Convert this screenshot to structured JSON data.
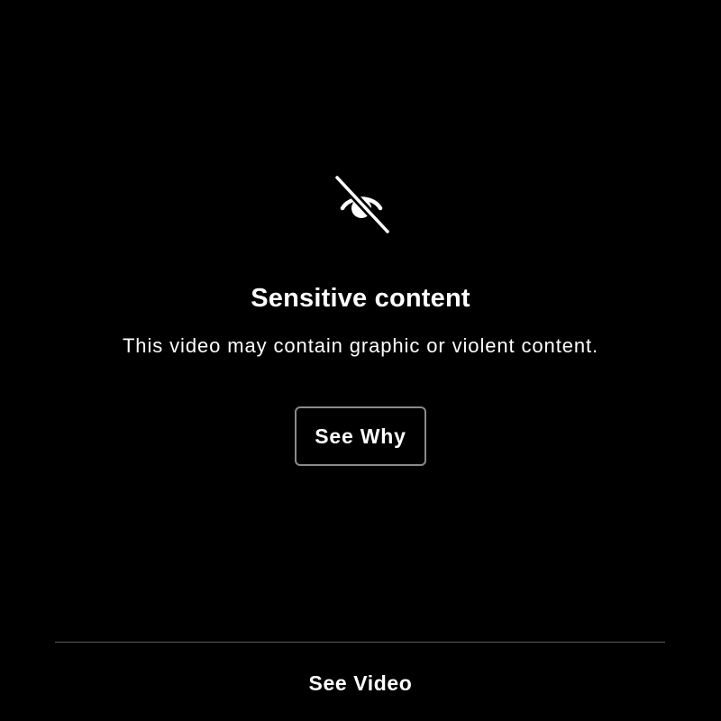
{
  "warning": {
    "icon": "eye-slash-icon",
    "title": "Sensitive content",
    "message": "This video may contain graphic or violent content.",
    "see_why_label": "See Why"
  },
  "footer": {
    "see_video_label": "See Video"
  },
  "colors": {
    "background": "#000000",
    "text": "#ffffff",
    "button_border": "#8a8a8a",
    "divider": "#5a5a5a"
  }
}
